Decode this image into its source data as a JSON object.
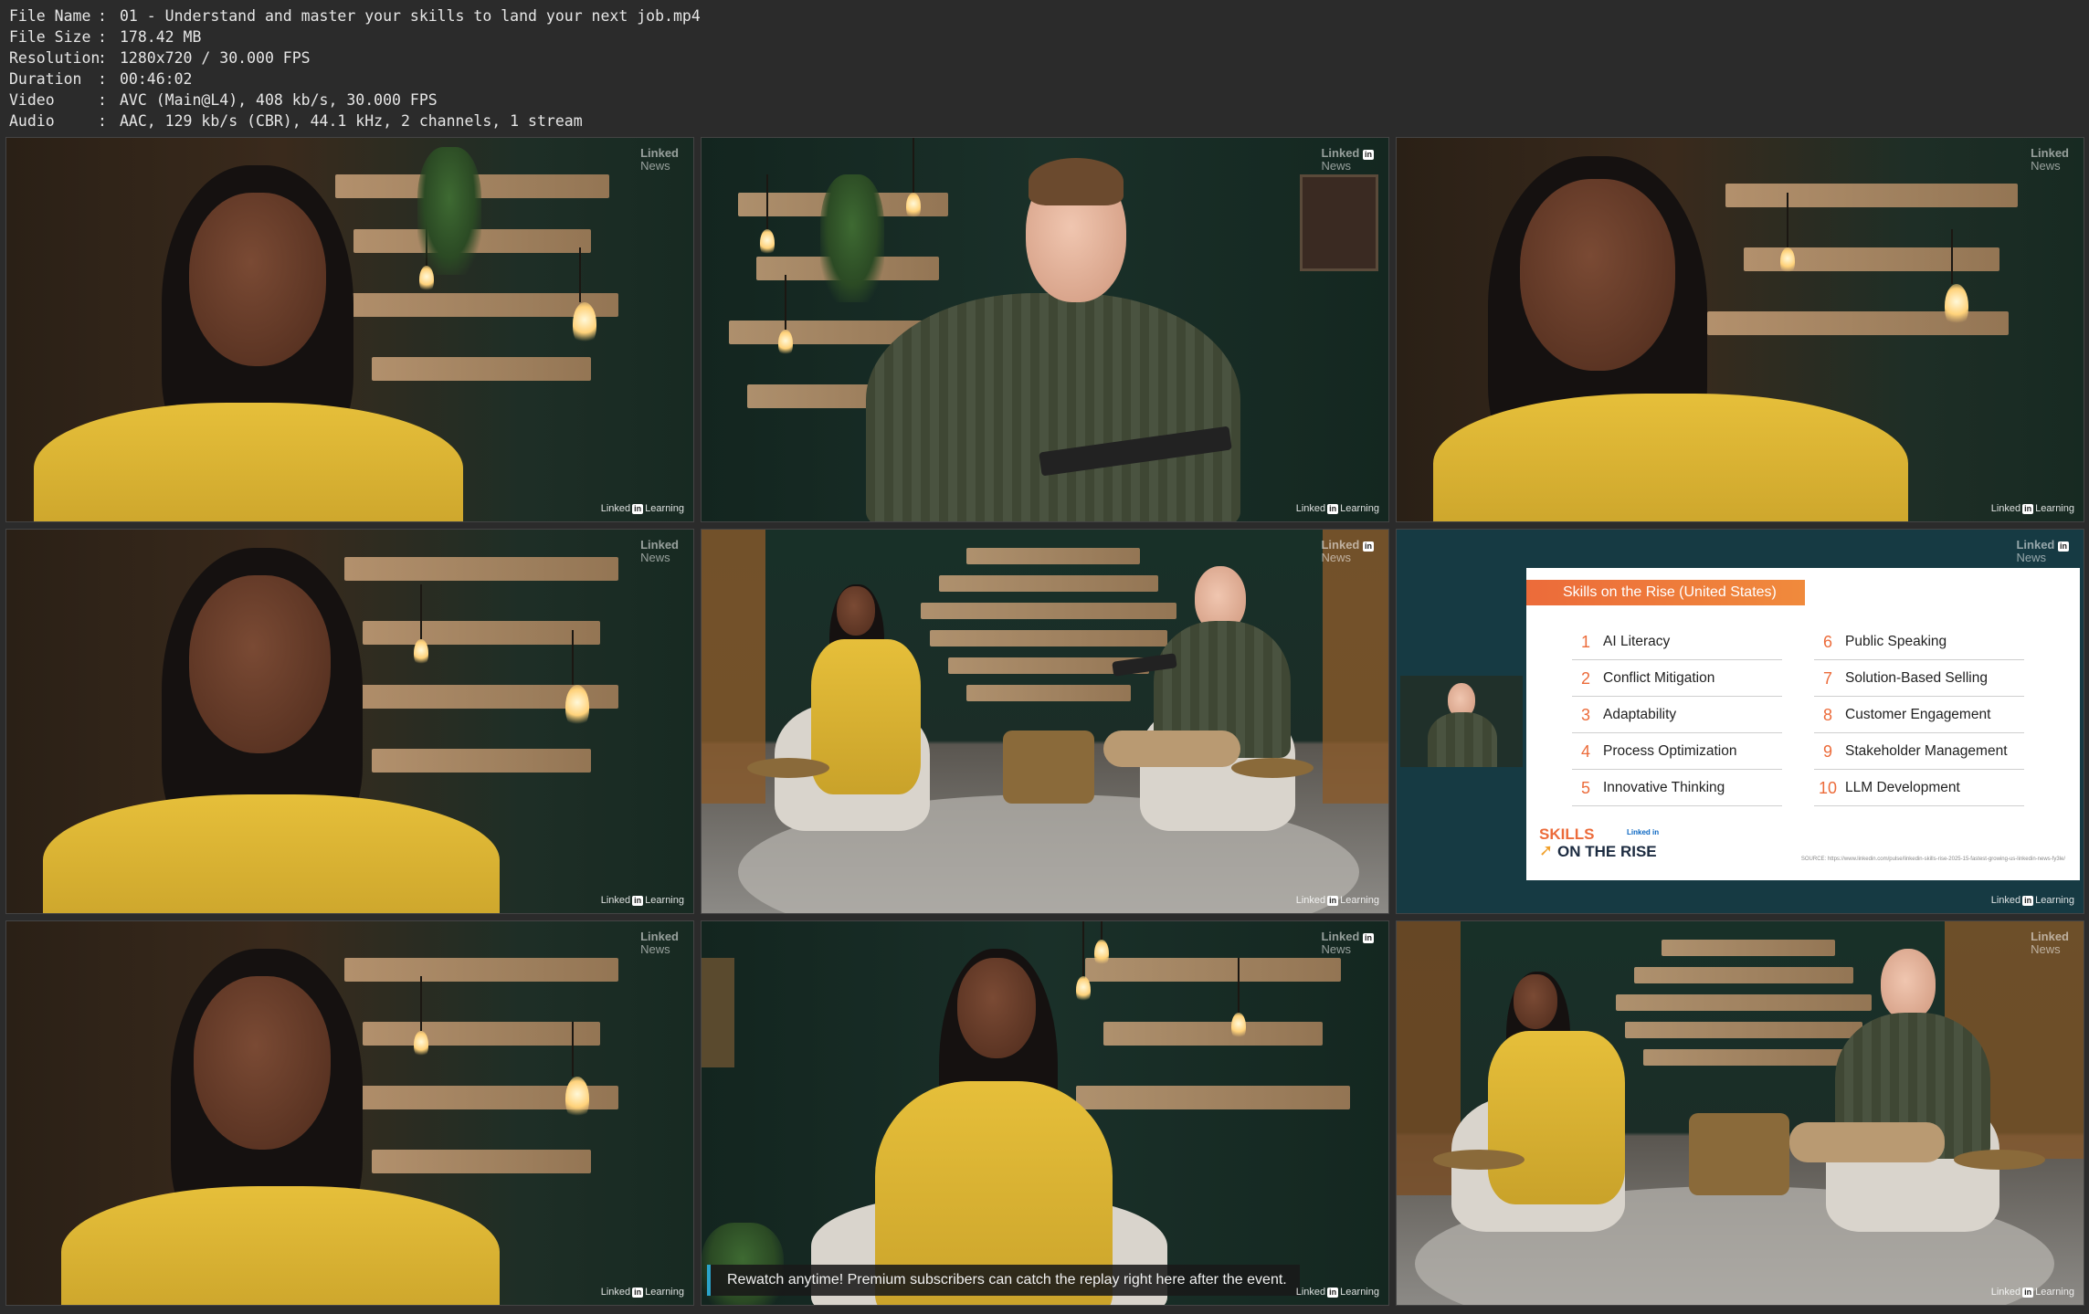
{
  "meta": [
    {
      "key": "File Name",
      "value": "01 - Understand and master your skills to land your next job.mp4"
    },
    {
      "key": "File Size",
      "value": "178.42 MB"
    },
    {
      "key": "Resolution",
      "value": "1280x720 / 30.000 FPS"
    },
    {
      "key": "Duration",
      "value": "00:46:02"
    },
    {
      "key": "Video",
      "value": "AVC (Main@L4), 408 kb/s, 30.000 FPS"
    },
    {
      "key": "Audio",
      "value": "AAC, 129 kb/s (CBR), 44.1 kHz, 2 channels, 1 stream"
    }
  ],
  "separator": ":",
  "watermark": {
    "news_top": "Linked",
    "news_in": "in",
    "news_bottom": "News",
    "learning_left": "Linked",
    "learning_in": "in",
    "learning_right": "Learning"
  },
  "slide": {
    "title": "Skills on the Rise (United States)",
    "skills": [
      {
        "num": "1",
        "label": "AI Literacy"
      },
      {
        "num": "2",
        "label": "Conflict Mitigation"
      },
      {
        "num": "3",
        "label": "Adaptability"
      },
      {
        "num": "4",
        "label": "Process Optimization"
      },
      {
        "num": "5",
        "label": "Innovative Thinking"
      },
      {
        "num": "6",
        "label": "Public Speaking"
      },
      {
        "num": "7",
        "label": "Solution-Based Selling"
      },
      {
        "num": "8",
        "label": "Customer Engagement"
      },
      {
        "num": "9",
        "label": "Stakeholder Management"
      },
      {
        "num": "10",
        "label": "LLM Development"
      }
    ],
    "logo_line1": "SKILLS",
    "logo_line2": "ON THE RISE",
    "logo_linkedin": "Linked in",
    "source": "SOURCE: https://www.linkedin.com/pulse/linkedin-skills-rise-2025-15-fastest-growing-us-linkedin-news-fy3le/"
  },
  "caption": "Rewatch anytime! Premium subscribers can catch the replay right here after the event."
}
